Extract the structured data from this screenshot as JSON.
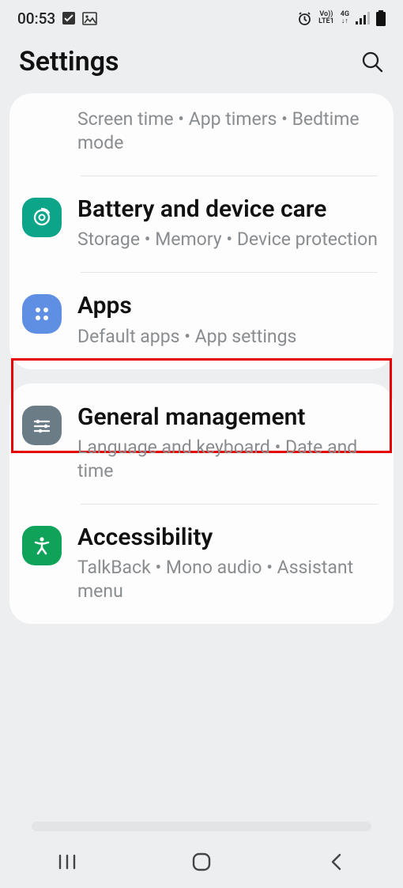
{
  "statusBar": {
    "time": "00:53",
    "netLine1": "Vo))",
    "netLine2": "LTE1",
    "netLine3": "4G"
  },
  "header": {
    "title": "Settings"
  },
  "card1": {
    "items": [
      {
        "title": "",
        "sub": "Screen time  •  App timers  •  Bedtime mode"
      },
      {
        "title": "Battery and device care",
        "sub": "Storage  •  Memory  •  Device protection"
      },
      {
        "title": "Apps",
        "sub": "Default apps  •  App settings"
      }
    ]
  },
  "card2": {
    "items": [
      {
        "title": "General management",
        "sub": "Language and keyboard  •  Date and time"
      },
      {
        "title": "Accessibility",
        "sub": "TalkBack  •  Mono audio  •  Assistant menu"
      }
    ]
  }
}
